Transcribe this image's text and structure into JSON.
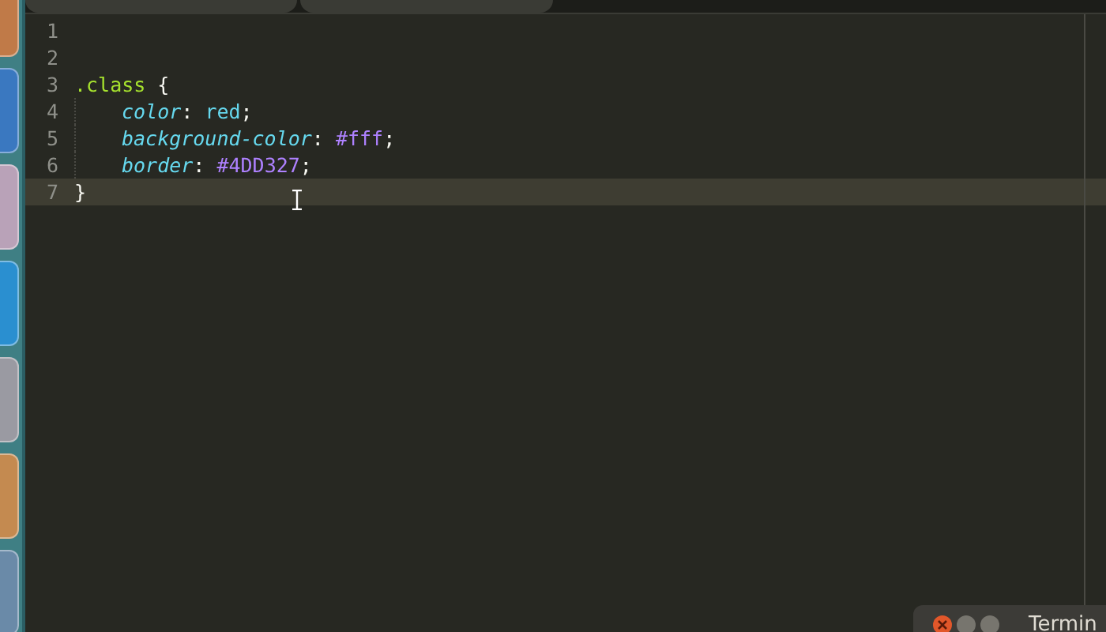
{
  "editor": {
    "lines": [
      {
        "number": "1",
        "current": false
      },
      {
        "number": "2",
        "current": false
      },
      {
        "number": "3",
        "current": false,
        "tokens": [
          {
            "kind": "selector",
            "text": ".class"
          },
          {
            "kind": "punct",
            "text": " {"
          }
        ]
      },
      {
        "number": "4",
        "current": false,
        "tokens": [
          {
            "kind": "property",
            "text": "color"
          },
          {
            "kind": "punct",
            "text": ": "
          },
          {
            "kind": "value",
            "text": "red"
          },
          {
            "kind": "punct",
            "text": ";"
          }
        ]
      },
      {
        "number": "5",
        "current": false,
        "tokens": [
          {
            "kind": "property",
            "text": "background-color"
          },
          {
            "kind": "punct",
            "text": ": "
          },
          {
            "kind": "number",
            "text": "#fff"
          },
          {
            "kind": "punct",
            "text": ";"
          }
        ]
      },
      {
        "number": "6",
        "current": false,
        "tokens": [
          {
            "kind": "property",
            "text": "border"
          },
          {
            "kind": "punct",
            "text": ": "
          },
          {
            "kind": "number",
            "text": "#4DD327"
          },
          {
            "kind": "punct",
            "text": ";"
          }
        ]
      },
      {
        "number": "7",
        "current": true,
        "tokens": [
          {
            "kind": "punct",
            "text": "}"
          }
        ]
      }
    ]
  },
  "terminal_window": {
    "title": "Termin"
  }
}
